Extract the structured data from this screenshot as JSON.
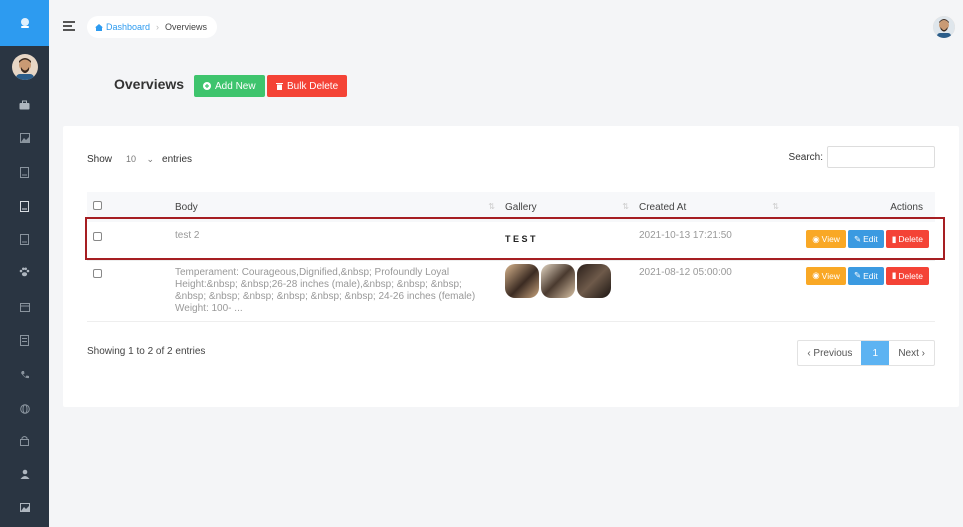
{
  "breadcrumb": {
    "home": "Dashboard",
    "current": "Overviews"
  },
  "header": {
    "title": "Overviews",
    "add_label": "Add New",
    "bulk_delete_label": "Bulk Delete"
  },
  "table_controls": {
    "show_label": "Show",
    "entries_value": "10",
    "entries_label": "entries",
    "search_label": "Search:",
    "search_value": ""
  },
  "table": {
    "columns": [
      "Body",
      "Gallery",
      "Created At",
      "Actions"
    ],
    "rows": [
      {
        "body": "test 2",
        "gallery_text": "TEST",
        "created_at": "2021-10-13 17:21:50",
        "highlighted": true
      },
      {
        "body": "Temperament: Courageous,Dignified,&nbsp; Profoundly Loyal Height:&nbsp; &nbsp;26-28 inches (male),&nbsp; &nbsp; &nbsp; &nbsp; &nbsp; &nbsp; &nbsp; &nbsp; &nbsp; 24-26 inches (female) Weight: 100- ...",
        "created_at": "2021-08-12 05:00:00",
        "highlighted": false
      }
    ],
    "action_labels": {
      "view": "View",
      "edit": "Edit",
      "delete": "Delete"
    }
  },
  "footer": {
    "showing": "Showing 1 to 2 of 2 entries",
    "previous": "‹ Previous",
    "page": "1",
    "next": "Next ›"
  },
  "colors": {
    "sidebar": "#2a3542",
    "sidebar_top": "#2d9bf0",
    "add_button": "#3ec46d",
    "delete_button": "#f44336",
    "view_button": "#f9a825",
    "edit_button": "#3b9ae1",
    "highlight": "#a61e22"
  },
  "icons": [
    "logo-icon",
    "briefcase-icon",
    "image-icon",
    "document-icon",
    "paw-icon",
    "calendar-icon",
    "phone-icon",
    "globe-icon",
    "lock-icon",
    "user-icon",
    "photo-icon",
    "plus-icon",
    "trash-icon",
    "eye-icon",
    "edit-icon",
    "home-icon"
  ]
}
